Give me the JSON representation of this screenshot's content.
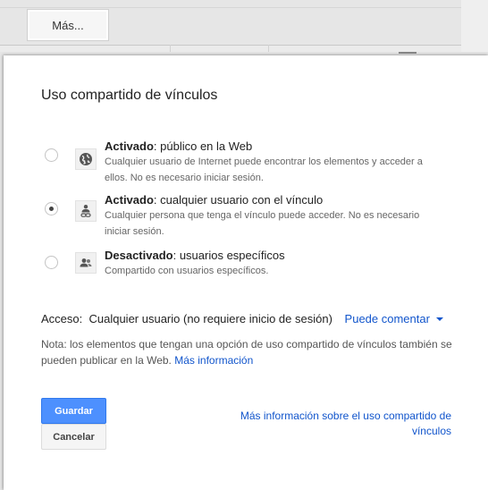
{
  "toolbar": {
    "more_label": "Más..."
  },
  "dialog": {
    "title": "Uso compartido de vínculos",
    "options": [
      {
        "head_bold": "Activado",
        "head_rest": ": público en la Web",
        "desc": "Cualquier usuario de Internet puede encontrar los elementos y acceder a ellos. No es necesario iniciar sesión.",
        "icon": "globe-icon",
        "selected": false
      },
      {
        "head_bold": "Activado",
        "head_rest": ": cualquier usuario con el vínculo",
        "desc": "Cualquier persona que tenga el vínculo puede acceder. No es necesario iniciar sesión.",
        "icon": "person-link-icon",
        "selected": true
      },
      {
        "head_bold": "Desactivado",
        "head_rest": ": usuarios específicos",
        "desc": "Compartido con usuarios específicos.",
        "icon": "people-icon",
        "selected": false
      }
    ],
    "access": {
      "label": "Acceso:",
      "value": "Cualquier usuario (no requiere inicio de sesión)",
      "permission": "Puede comentar"
    },
    "note": {
      "text": "Nota: los elementos que tengan una opción de uso compartido de vínculos también se pueden publicar en la Web.",
      "link": "Más información"
    },
    "buttons": {
      "save": "Guardar",
      "cancel": "Cancelar"
    },
    "more_info_link": "Más información sobre el uso compartido de vínculos"
  },
  "colors": {
    "link": "#1155cc",
    "primary_button": "#4d90fe"
  }
}
